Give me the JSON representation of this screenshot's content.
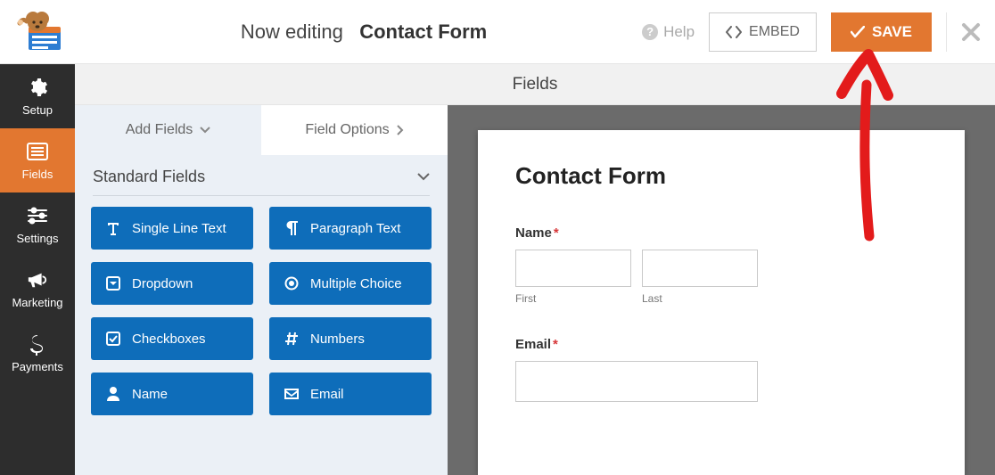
{
  "header": {
    "editing_prefix": "Now editing",
    "form_name": "Contact Form",
    "help_label": "Help",
    "embed_label": "EMBED",
    "save_label": "SAVE"
  },
  "sidenav": {
    "items": [
      {
        "label": "Setup",
        "icon": "gear-icon"
      },
      {
        "label": "Fields",
        "icon": "list-icon"
      },
      {
        "label": "Settings",
        "icon": "sliders-icon"
      },
      {
        "label": "Marketing",
        "icon": "bullhorn-icon"
      },
      {
        "label": "Payments",
        "icon": "dollar-icon"
      }
    ],
    "active_index": 1
  },
  "subheader": {
    "title": "Fields"
  },
  "tabs": {
    "items": [
      {
        "label": "Add Fields"
      },
      {
        "label": "Field Options"
      }
    ],
    "active_index": 0
  },
  "field_group": {
    "title": "Standard Fields",
    "buttons": [
      {
        "label": "Single Line Text",
        "icon": "text-icon"
      },
      {
        "label": "Paragraph Text",
        "icon": "paragraph-icon"
      },
      {
        "label": "Dropdown",
        "icon": "caret-square-icon"
      },
      {
        "label": "Multiple Choice",
        "icon": "radio-icon"
      },
      {
        "label": "Checkboxes",
        "icon": "checkbox-icon"
      },
      {
        "label": "Numbers",
        "icon": "hash-icon"
      },
      {
        "label": "Name",
        "icon": "user-icon"
      },
      {
        "label": "Email",
        "icon": "envelope-icon"
      }
    ]
  },
  "preview": {
    "form_title": "Contact Form",
    "fields": {
      "name": {
        "label": "Name",
        "required": true,
        "first_sub": "First",
        "last_sub": "Last"
      },
      "email": {
        "label": "Email",
        "required": true
      }
    }
  },
  "required_marker": "*"
}
